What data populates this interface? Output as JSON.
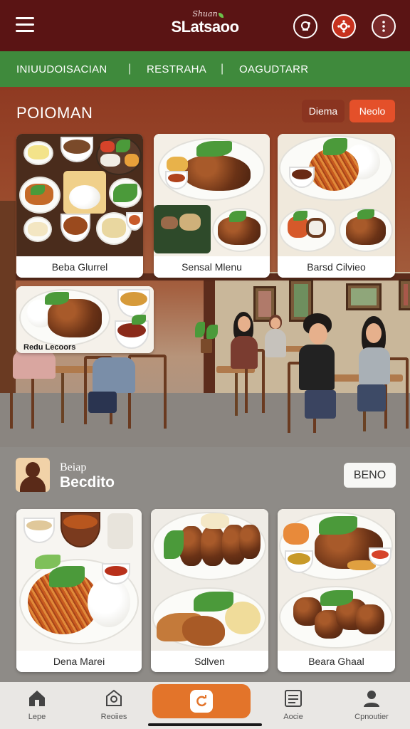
{
  "app": {
    "brand_small": "Shuan",
    "brand_name": "SLatsaoo"
  },
  "categories": [
    "INIUUDOISACIAN",
    "RESTRAHA",
    "OAGUDTARR"
  ],
  "hero": {
    "title": "POIOMAN",
    "chip_primary": "Diema",
    "chip_secondary": "Neolo",
    "cards": [
      {
        "caption": "Beba Glurrel"
      },
      {
        "caption": "Sensal Mlenu"
      },
      {
        "caption": "Barsd Cilvieo"
      },
      {
        "caption": "Redu Lecoors"
      }
    ]
  },
  "section2": {
    "small_title": "Beiap",
    "title": "Becdito",
    "button": "BENO",
    "cards": [
      {
        "caption": "Dena Marei"
      },
      {
        "caption": "Sdlven"
      },
      {
        "caption": "Beara Ghaal"
      }
    ]
  },
  "bottom_nav": [
    {
      "label": "Lepe",
      "icon": "home-icon"
    },
    {
      "label": "Reoiies",
      "icon": "food-box-icon"
    },
    {
      "label": "",
      "icon": "refresh-icon"
    },
    {
      "label": "Aocie",
      "icon": "list-icon"
    },
    {
      "label": "Cpnoutier",
      "icon": "person-icon"
    }
  ],
  "colors": {
    "appbar": "#5a1414",
    "catbar": "#3f8a3c",
    "accent": "#e4502a",
    "center_button": "#e3742a"
  }
}
